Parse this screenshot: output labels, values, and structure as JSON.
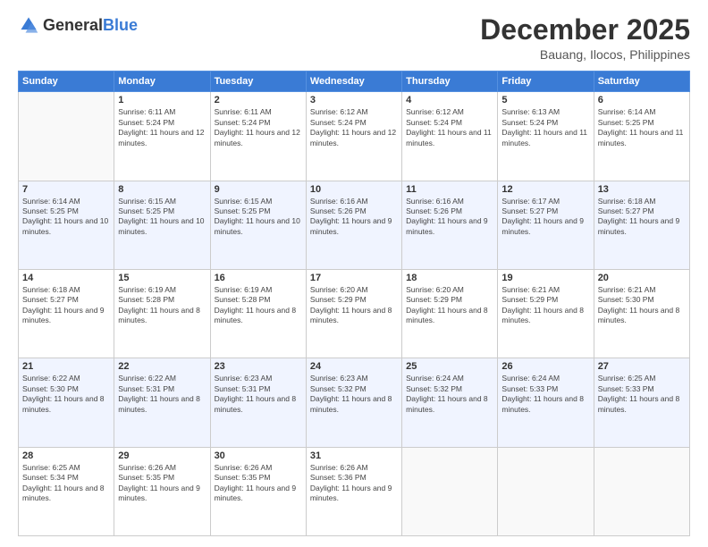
{
  "header": {
    "logo_general": "General",
    "logo_blue": "Blue",
    "month": "December 2025",
    "location": "Bauang, Ilocos, Philippines"
  },
  "days_of_week": [
    "Sunday",
    "Monday",
    "Tuesday",
    "Wednesday",
    "Thursday",
    "Friday",
    "Saturday"
  ],
  "weeks": [
    [
      {
        "day": "",
        "sunrise": "",
        "sunset": "",
        "daylight": ""
      },
      {
        "day": "1",
        "sunrise": "Sunrise: 6:11 AM",
        "sunset": "Sunset: 5:24 PM",
        "daylight": "Daylight: 11 hours and 12 minutes."
      },
      {
        "day": "2",
        "sunrise": "Sunrise: 6:11 AM",
        "sunset": "Sunset: 5:24 PM",
        "daylight": "Daylight: 11 hours and 12 minutes."
      },
      {
        "day": "3",
        "sunrise": "Sunrise: 6:12 AM",
        "sunset": "Sunset: 5:24 PM",
        "daylight": "Daylight: 11 hours and 12 minutes."
      },
      {
        "day": "4",
        "sunrise": "Sunrise: 6:12 AM",
        "sunset": "Sunset: 5:24 PM",
        "daylight": "Daylight: 11 hours and 11 minutes."
      },
      {
        "day": "5",
        "sunrise": "Sunrise: 6:13 AM",
        "sunset": "Sunset: 5:24 PM",
        "daylight": "Daylight: 11 hours and 11 minutes."
      },
      {
        "day": "6",
        "sunrise": "Sunrise: 6:14 AM",
        "sunset": "Sunset: 5:25 PM",
        "daylight": "Daylight: 11 hours and 11 minutes."
      }
    ],
    [
      {
        "day": "7",
        "sunrise": "Sunrise: 6:14 AM",
        "sunset": "Sunset: 5:25 PM",
        "daylight": "Daylight: 11 hours and 10 minutes."
      },
      {
        "day": "8",
        "sunrise": "Sunrise: 6:15 AM",
        "sunset": "Sunset: 5:25 PM",
        "daylight": "Daylight: 11 hours and 10 minutes."
      },
      {
        "day": "9",
        "sunrise": "Sunrise: 6:15 AM",
        "sunset": "Sunset: 5:25 PM",
        "daylight": "Daylight: 11 hours and 10 minutes."
      },
      {
        "day": "10",
        "sunrise": "Sunrise: 6:16 AM",
        "sunset": "Sunset: 5:26 PM",
        "daylight": "Daylight: 11 hours and 9 minutes."
      },
      {
        "day": "11",
        "sunrise": "Sunrise: 6:16 AM",
        "sunset": "Sunset: 5:26 PM",
        "daylight": "Daylight: 11 hours and 9 minutes."
      },
      {
        "day": "12",
        "sunrise": "Sunrise: 6:17 AM",
        "sunset": "Sunset: 5:27 PM",
        "daylight": "Daylight: 11 hours and 9 minutes."
      },
      {
        "day": "13",
        "sunrise": "Sunrise: 6:18 AM",
        "sunset": "Sunset: 5:27 PM",
        "daylight": "Daylight: 11 hours and 9 minutes."
      }
    ],
    [
      {
        "day": "14",
        "sunrise": "Sunrise: 6:18 AM",
        "sunset": "Sunset: 5:27 PM",
        "daylight": "Daylight: 11 hours and 9 minutes."
      },
      {
        "day": "15",
        "sunrise": "Sunrise: 6:19 AM",
        "sunset": "Sunset: 5:28 PM",
        "daylight": "Daylight: 11 hours and 8 minutes."
      },
      {
        "day": "16",
        "sunrise": "Sunrise: 6:19 AM",
        "sunset": "Sunset: 5:28 PM",
        "daylight": "Daylight: 11 hours and 8 minutes."
      },
      {
        "day": "17",
        "sunrise": "Sunrise: 6:20 AM",
        "sunset": "Sunset: 5:29 PM",
        "daylight": "Daylight: 11 hours and 8 minutes."
      },
      {
        "day": "18",
        "sunrise": "Sunrise: 6:20 AM",
        "sunset": "Sunset: 5:29 PM",
        "daylight": "Daylight: 11 hours and 8 minutes."
      },
      {
        "day": "19",
        "sunrise": "Sunrise: 6:21 AM",
        "sunset": "Sunset: 5:29 PM",
        "daylight": "Daylight: 11 hours and 8 minutes."
      },
      {
        "day": "20",
        "sunrise": "Sunrise: 6:21 AM",
        "sunset": "Sunset: 5:30 PM",
        "daylight": "Daylight: 11 hours and 8 minutes."
      }
    ],
    [
      {
        "day": "21",
        "sunrise": "Sunrise: 6:22 AM",
        "sunset": "Sunset: 5:30 PM",
        "daylight": "Daylight: 11 hours and 8 minutes."
      },
      {
        "day": "22",
        "sunrise": "Sunrise: 6:22 AM",
        "sunset": "Sunset: 5:31 PM",
        "daylight": "Daylight: 11 hours and 8 minutes."
      },
      {
        "day": "23",
        "sunrise": "Sunrise: 6:23 AM",
        "sunset": "Sunset: 5:31 PM",
        "daylight": "Daylight: 11 hours and 8 minutes."
      },
      {
        "day": "24",
        "sunrise": "Sunrise: 6:23 AM",
        "sunset": "Sunset: 5:32 PM",
        "daylight": "Daylight: 11 hours and 8 minutes."
      },
      {
        "day": "25",
        "sunrise": "Sunrise: 6:24 AM",
        "sunset": "Sunset: 5:32 PM",
        "daylight": "Daylight: 11 hours and 8 minutes."
      },
      {
        "day": "26",
        "sunrise": "Sunrise: 6:24 AM",
        "sunset": "Sunset: 5:33 PM",
        "daylight": "Daylight: 11 hours and 8 minutes."
      },
      {
        "day": "27",
        "sunrise": "Sunrise: 6:25 AM",
        "sunset": "Sunset: 5:33 PM",
        "daylight": "Daylight: 11 hours and 8 minutes."
      }
    ],
    [
      {
        "day": "28",
        "sunrise": "Sunrise: 6:25 AM",
        "sunset": "Sunset: 5:34 PM",
        "daylight": "Daylight: 11 hours and 8 minutes."
      },
      {
        "day": "29",
        "sunrise": "Sunrise: 6:26 AM",
        "sunset": "Sunset: 5:35 PM",
        "daylight": "Daylight: 11 hours and 9 minutes."
      },
      {
        "day": "30",
        "sunrise": "Sunrise: 6:26 AM",
        "sunset": "Sunset: 5:35 PM",
        "daylight": "Daylight: 11 hours and 9 minutes."
      },
      {
        "day": "31",
        "sunrise": "Sunrise: 6:26 AM",
        "sunset": "Sunset: 5:36 PM",
        "daylight": "Daylight: 11 hours and 9 minutes."
      },
      {
        "day": "",
        "sunrise": "",
        "sunset": "",
        "daylight": ""
      },
      {
        "day": "",
        "sunrise": "",
        "sunset": "",
        "daylight": ""
      },
      {
        "day": "",
        "sunrise": "",
        "sunset": "",
        "daylight": ""
      }
    ]
  ]
}
